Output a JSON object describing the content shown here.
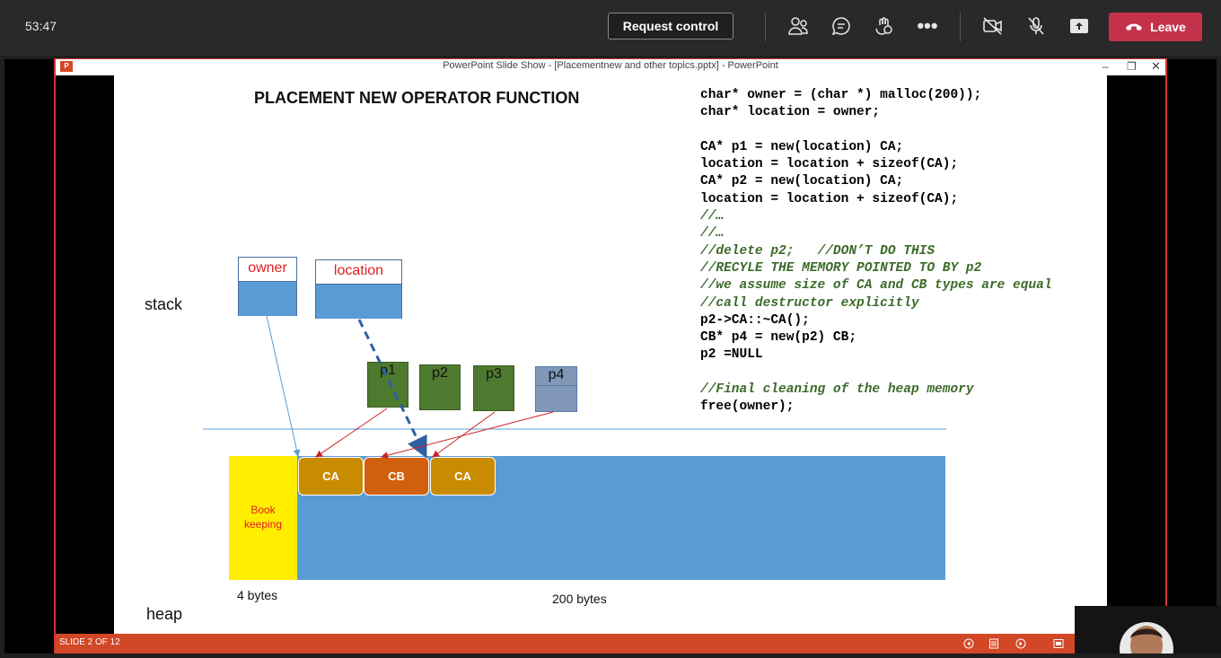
{
  "teams": {
    "timer": "53:47",
    "request_control_label": "Request control",
    "leave_label": "Leave",
    "icons": [
      "people-icon",
      "chat-icon",
      "reactions-icon",
      "more-icon",
      "camera-off-icon",
      "mic-off-icon",
      "share-icon",
      "hangup-icon"
    ]
  },
  "ppt": {
    "window_title": "PowerPoint Slide Show - [Placementnew and other topics.pptx] - PowerPoint",
    "status": {
      "slide_label": "SLIDE 2 OF 12"
    }
  },
  "slide": {
    "title": "PLACEMENT NEW OPERATOR FUNCTION",
    "code": [
      {
        "t": "char* owner = (char *) malloc(200));",
        "c": false
      },
      {
        "t": "char* location = owner;",
        "c": false
      },
      {
        "t": "",
        "c": false
      },
      {
        "t": "CA* p1 = new(location) CA;",
        "c": false
      },
      {
        "t": "location = location + sizeof(CA);",
        "c": false
      },
      {
        "t": "CA* p2 = new(location) CA;",
        "c": false
      },
      {
        "t": "location = location + sizeof(CA);",
        "c": false
      },
      {
        "t": "//…",
        "c": true
      },
      {
        "t": "//…",
        "c": true
      },
      {
        "t": "//delete p2;   //DON’T DO THIS",
        "c": true
      },
      {
        "t": "//RECYLE THE MEMORY POINTED TO BY p2",
        "c": true
      },
      {
        "t": "//we assume size of CA and CB types are equal",
        "c": true
      },
      {
        "t": "//call destructor explicitly",
        "c": true
      },
      {
        "t": "p2->CA::~CA();",
        "c": false
      },
      {
        "t": "CB* p4 = new(p2) CB;",
        "c": false
      },
      {
        "t": "p2 =NULL",
        "c": false
      },
      {
        "t": "",
        "c": false
      },
      {
        "t": "//Final cleaning of the heap memory",
        "c": true
      },
      {
        "t": "free(owner);",
        "c": false
      }
    ],
    "diagram": {
      "stack_label": "stack",
      "heap_label": "heap",
      "owner_label": "owner",
      "location_label": "location",
      "pointers": [
        "p1",
        "p2",
        "p3",
        "p4"
      ],
      "book_line1": "Book",
      "book_line2": "keeping",
      "objects": [
        "CA",
        "CB",
        "CA"
      ],
      "bytes_4": "4 bytes",
      "bytes_200": "200 bytes",
      "colors": {
        "heap": "#5b9bd5",
        "book": "#ffee00",
        "ca": "#c98b00",
        "cb": "#d0600e",
        "pointer": "#4e7a30",
        "p4": "#8097b8"
      }
    }
  }
}
